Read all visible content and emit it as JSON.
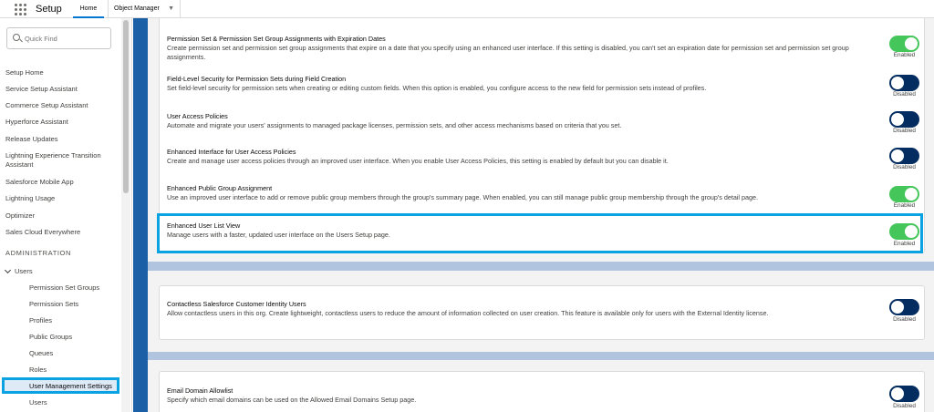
{
  "header": {
    "app_name": "Setup",
    "tabs": [
      {
        "label": "Home"
      },
      {
        "label": "Object Manager"
      }
    ]
  },
  "sidebar": {
    "search_placeholder": "Quick Find",
    "items": [
      "Setup Home",
      "Service Setup Assistant",
      "Commerce Setup Assistant",
      "Hyperforce Assistant",
      "Release Updates",
      "Lightning Experience Transition Assistant",
      "Salesforce Mobile App",
      "Lightning Usage",
      "Optimizer",
      "Sales Cloud Everywhere"
    ],
    "section_heading": "ADMINISTRATION",
    "users_group": "Users",
    "sub_items": [
      "Permission Set Groups",
      "Permission Sets",
      "Profiles",
      "Public Groups",
      "Queues",
      "Roles",
      "User Management Settings",
      "Users"
    ]
  },
  "settings": [
    {
      "title": "Permission Set & Permission Set Group Assignments with Expiration Dates",
      "description": "Create permission set and permission set group assignments that expire on a date that you specify using an enhanced user interface. If this setting is disabled, you can't set an expiration date for permission set and permission set group assignments.",
      "state": "Enabled"
    },
    {
      "title": "Field-Level Security for Permission Sets during Field Creation",
      "description": "Set field-level security for permission sets when creating or editing custom fields. When this option is enabled, you configure access to the new field for permission sets instead of profiles.",
      "state": "Disabled"
    },
    {
      "title": "User Access Policies",
      "description": "Automate and migrate your users' assignments to managed package licenses, permission sets, and other access mechanisms based on criteria that you set.",
      "state": "Disabled"
    },
    {
      "title": "Enhanced Interface for User Access Policies",
      "description": "Create and manage user access policies through an improved user interface. When you enable User Access Policies, this setting is enabled by default but you can disable it.",
      "state": "Disabled"
    },
    {
      "title": "Enhanced Public Group Assignment",
      "description": "Use an improved user interface to add or remove public group members through the group's summary page. When enabled, you can still manage public group membership through the group's detail page.",
      "state": "Enabled"
    },
    {
      "title": "Enhanced User List View",
      "description": "Manage users with a faster, updated user interface on the Users Setup page.",
      "state": "Enabled"
    },
    {
      "title": "Contactless Salesforce Customer Identity Users",
      "description": "Allow contactless users in this org. Create lightweight, contactless users to reduce the amount of information collected on user creation. This feature is available only for users with the External Identity license.",
      "state": "Disabled"
    },
    {
      "title": "Email Domain Allowlist",
      "description": "Specify which email domains can be used on the Allowed Email Domains Setup page.",
      "state": "Disabled"
    }
  ],
  "colors": {
    "enabled": "#45c65a",
    "disabled": "#032d60",
    "highlight": "#0aa2e0"
  }
}
